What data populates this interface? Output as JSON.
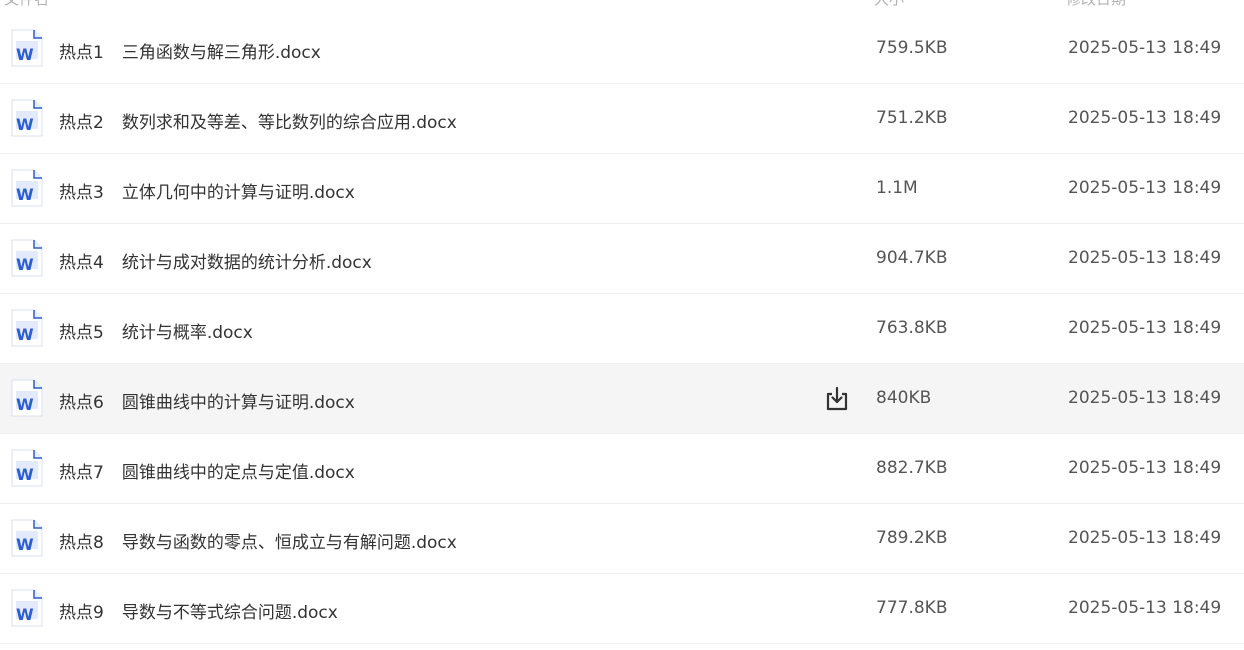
{
  "header": {
    "name": "文件名",
    "size": "大小",
    "date": "修改日期"
  },
  "files": [
    {
      "num": "热点1",
      "title": "三角函数与解三角形.docx",
      "size": "759.5KB",
      "date": "2025-05-13 18:49"
    },
    {
      "num": "热点2",
      "title": "数列求和及等差、等比数列的综合应用.docx",
      "size": "751.2KB",
      "date": "2025-05-13 18:49"
    },
    {
      "num": "热点3",
      "title": "立体几何中的计算与证明.docx",
      "size": "1.1M",
      "date": "2025-05-13 18:49"
    },
    {
      "num": "热点4",
      "title": "统计与成对数据的统计分析.docx",
      "size": "904.7KB",
      "date": "2025-05-13 18:49"
    },
    {
      "num": "热点5",
      "title": "统计与概率.docx",
      "size": "763.8KB",
      "date": "2025-05-13 18:49"
    },
    {
      "num": "热点6",
      "title": "圆锥曲线中的计算与证明.docx",
      "size": "840KB",
      "date": "2025-05-13 18:49"
    },
    {
      "num": "热点7",
      "title": "圆锥曲线中的定点与定值.docx",
      "size": "882.7KB",
      "date": "2025-05-13 18:49"
    },
    {
      "num": "热点8",
      "title": "导数与函数的零点、恒成立与有解问题.docx",
      "size": "789.2KB",
      "date": "2025-05-13 18:49"
    },
    {
      "num": "热点9",
      "title": "导数与不等式综合问题.docx",
      "size": "777.8KB",
      "date": "2025-05-13 18:49"
    }
  ],
  "icons": {
    "file_type": "word-doc-icon",
    "download": "download-icon"
  },
  "colors": {
    "word_blue": "#2b5fd0",
    "hover_row": "#f5f5f5"
  }
}
